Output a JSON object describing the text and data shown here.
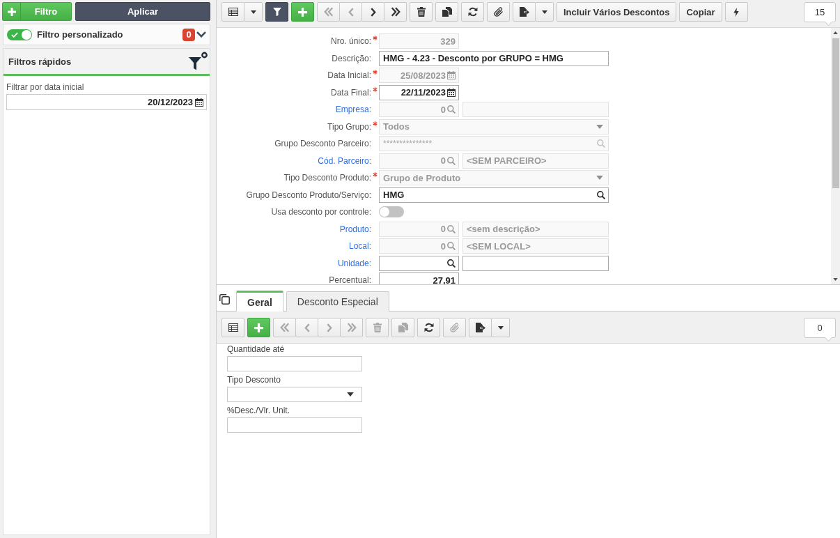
{
  "sidebar": {
    "filter_button": {
      "label": "Filtro"
    },
    "apply_button": {
      "label": "Aplicar"
    },
    "custom_filter": {
      "label": "Filtro personalizado",
      "on": true,
      "count": "0",
      "expanded": false
    },
    "quick_filters": {
      "title": "Filtros rápidos",
      "fields": [
        {
          "label": "Filtrar por data inicial",
          "value": "20/12/2023"
        }
      ]
    }
  },
  "toolbar": {
    "groups": [
      [
        {
          "kind": "grid",
          "active": false,
          "disabled": false
        },
        {
          "kind": "menu",
          "active": false,
          "disabled": false
        }
      ],
      [
        {
          "kind": "filter",
          "active": true,
          "disabled": false
        }
      ],
      [
        {
          "kind": "add",
          "active": false,
          "disabled": false
        }
      ],
      [
        {
          "kind": "first",
          "active": false,
          "disabled": true
        },
        {
          "kind": "previous",
          "active": false,
          "disabled": true
        },
        {
          "kind": "next",
          "active": false,
          "disabled": false
        },
        {
          "kind": "last",
          "active": false,
          "disabled": false
        }
      ],
      [
        {
          "kind": "delete",
          "active": false,
          "disabled": false
        }
      ],
      [
        {
          "kind": "duplicate",
          "active": false,
          "disabled": false
        }
      ],
      [
        {
          "kind": "refresh",
          "active": false,
          "disabled": false
        }
      ],
      [
        {
          "kind": "attach",
          "active": false,
          "disabled": false
        }
      ],
      [
        {
          "kind": "export",
          "active": false,
          "disabled": false
        },
        {
          "kind": "menu",
          "active": false,
          "disabled": false
        }
      ],
      [
        {
          "kind": "text",
          "label": "Incluir Vários Descontos",
          "active": false,
          "disabled": false
        }
      ],
      [
        {
          "kind": "text",
          "label": "Copiar",
          "active": false,
          "disabled": false
        }
      ],
      [
        {
          "kind": "action",
          "active": false,
          "disabled": false
        }
      ]
    ],
    "record_count": "15"
  },
  "form": {
    "fields": [
      {
        "kind": "number",
        "label": "Nro. único:",
        "required": true,
        "link": false,
        "disabled": true,
        "value": "329"
      },
      {
        "kind": "text",
        "label": "Descrição:",
        "required": false,
        "link": false,
        "disabled": false,
        "value": "HMG - 4.23 - Desconto por GRUPO = HMG"
      },
      {
        "kind": "date",
        "label": "Data Inicial:",
        "required": true,
        "link": false,
        "disabled": true,
        "value": "25/08/2023"
      },
      {
        "kind": "date",
        "label": "Data Final:",
        "required": true,
        "link": false,
        "disabled": false,
        "value": "22/11/2023"
      },
      {
        "kind": "lookup",
        "label": "Empresa:",
        "required": false,
        "link": true,
        "disabled": true,
        "value": "0"
      },
      {
        "kind": "select",
        "label": "Tipo Grupo:",
        "required": true,
        "link": false,
        "disabled": true,
        "value": "Todos"
      },
      {
        "kind": "search",
        "label": "Grupo Desconto Parceiro:",
        "required": false,
        "link": false,
        "disabled": true,
        "value": "***************"
      },
      {
        "kind": "lookup",
        "label": "Cód. Parceiro:",
        "required": false,
        "link": true,
        "disabled": true,
        "value": "0",
        "description": "<SEM PARCEIRO>"
      },
      {
        "kind": "select",
        "label": "Tipo Desconto Produto:",
        "required": true,
        "link": false,
        "disabled": true,
        "value": "Grupo de Produto"
      },
      {
        "kind": "search",
        "label": "Grupo Desconto Produto/Serviço:",
        "required": false,
        "link": false,
        "disabled": false,
        "value": "HMG"
      },
      {
        "kind": "toggle",
        "label": "Usa desconto por controle:",
        "required": false,
        "link": false,
        "disabled": false,
        "on": false
      },
      {
        "kind": "lookup",
        "label": "Produto:",
        "required": false,
        "link": true,
        "disabled": true,
        "value": "0",
        "description": "<sem descrição>"
      },
      {
        "kind": "lookup",
        "label": "Local:",
        "required": false,
        "link": true,
        "disabled": true,
        "value": "0",
        "description": "<SEM LOCAL>"
      },
      {
        "kind": "lookup",
        "label": "Unidade:",
        "required": false,
        "link": true,
        "disabled": false
      },
      {
        "kind": "number",
        "label": "Percentual:",
        "required": false,
        "link": false,
        "disabled": false,
        "value": "27,91"
      }
    ]
  },
  "detail": {
    "tabs": [
      {
        "label": "Geral",
        "selected": true
      },
      {
        "label": "Desconto Especial",
        "selected": false
      }
    ],
    "toolbar": {
      "groups": [
        [
          {
            "kind": "grid",
            "active": false,
            "disabled": false
          }
        ],
        [
          {
            "kind": "add",
            "active": false,
            "disabled": false
          }
        ],
        [
          {
            "kind": "first",
            "active": false,
            "disabled": true
          },
          {
            "kind": "previous",
            "active": false,
            "disabled": true
          },
          {
            "kind": "next",
            "active": false,
            "disabled": true
          },
          {
            "kind": "last",
            "active": false,
            "disabled": true
          }
        ],
        [
          {
            "kind": "delete",
            "active": false,
            "disabled": true
          }
        ],
        [
          {
            "kind": "duplicate",
            "active": false,
            "disabled": true
          }
        ],
        [
          {
            "kind": "refresh",
            "active": false,
            "disabled": false
          }
        ],
        [
          {
            "kind": "attach",
            "active": false,
            "disabled": true
          }
        ],
        [
          {
            "kind": "export",
            "active": false,
            "disabled": false
          },
          {
            "kind": "menu",
            "active": false,
            "disabled": false
          }
        ]
      ],
      "record_count": "0"
    },
    "fields": [
      {
        "kind": "text",
        "label": "Quantidade até"
      },
      {
        "kind": "select",
        "label": "Tipo Desconto"
      },
      {
        "kind": "text",
        "label": "%Desc./Vlr. Unit."
      }
    ]
  }
}
